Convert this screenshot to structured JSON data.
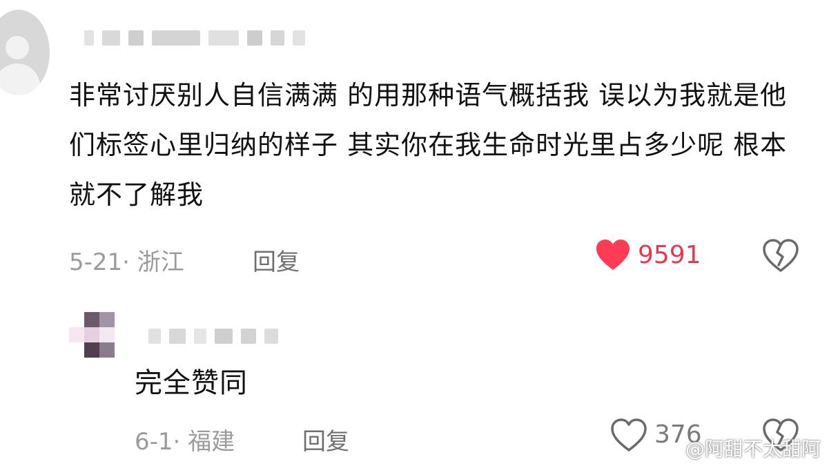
{
  "comment": {
    "text": "非常讨厌别人自信满满 的用那种语气概括我 误以为我就是他们标签心里归纳的样子 其实你在我生命时光里占多少呢 根本就不了解我",
    "date_location": "5-21· 浙江",
    "reply_label": "回复",
    "likes": "9591",
    "like_icon": "heart-filled-icon",
    "dislike_icon": "broken-heart-icon",
    "like_color": "#ff3b55"
  },
  "reply_comment": {
    "text": "完全赞同",
    "date_location": "6-1· 福建",
    "reply_label": "回复",
    "likes": "376",
    "like_icon": "heart-outline-icon",
    "dislike_icon": "broken-heart-icon"
  },
  "watermark": "@阿甜不太甜阿"
}
